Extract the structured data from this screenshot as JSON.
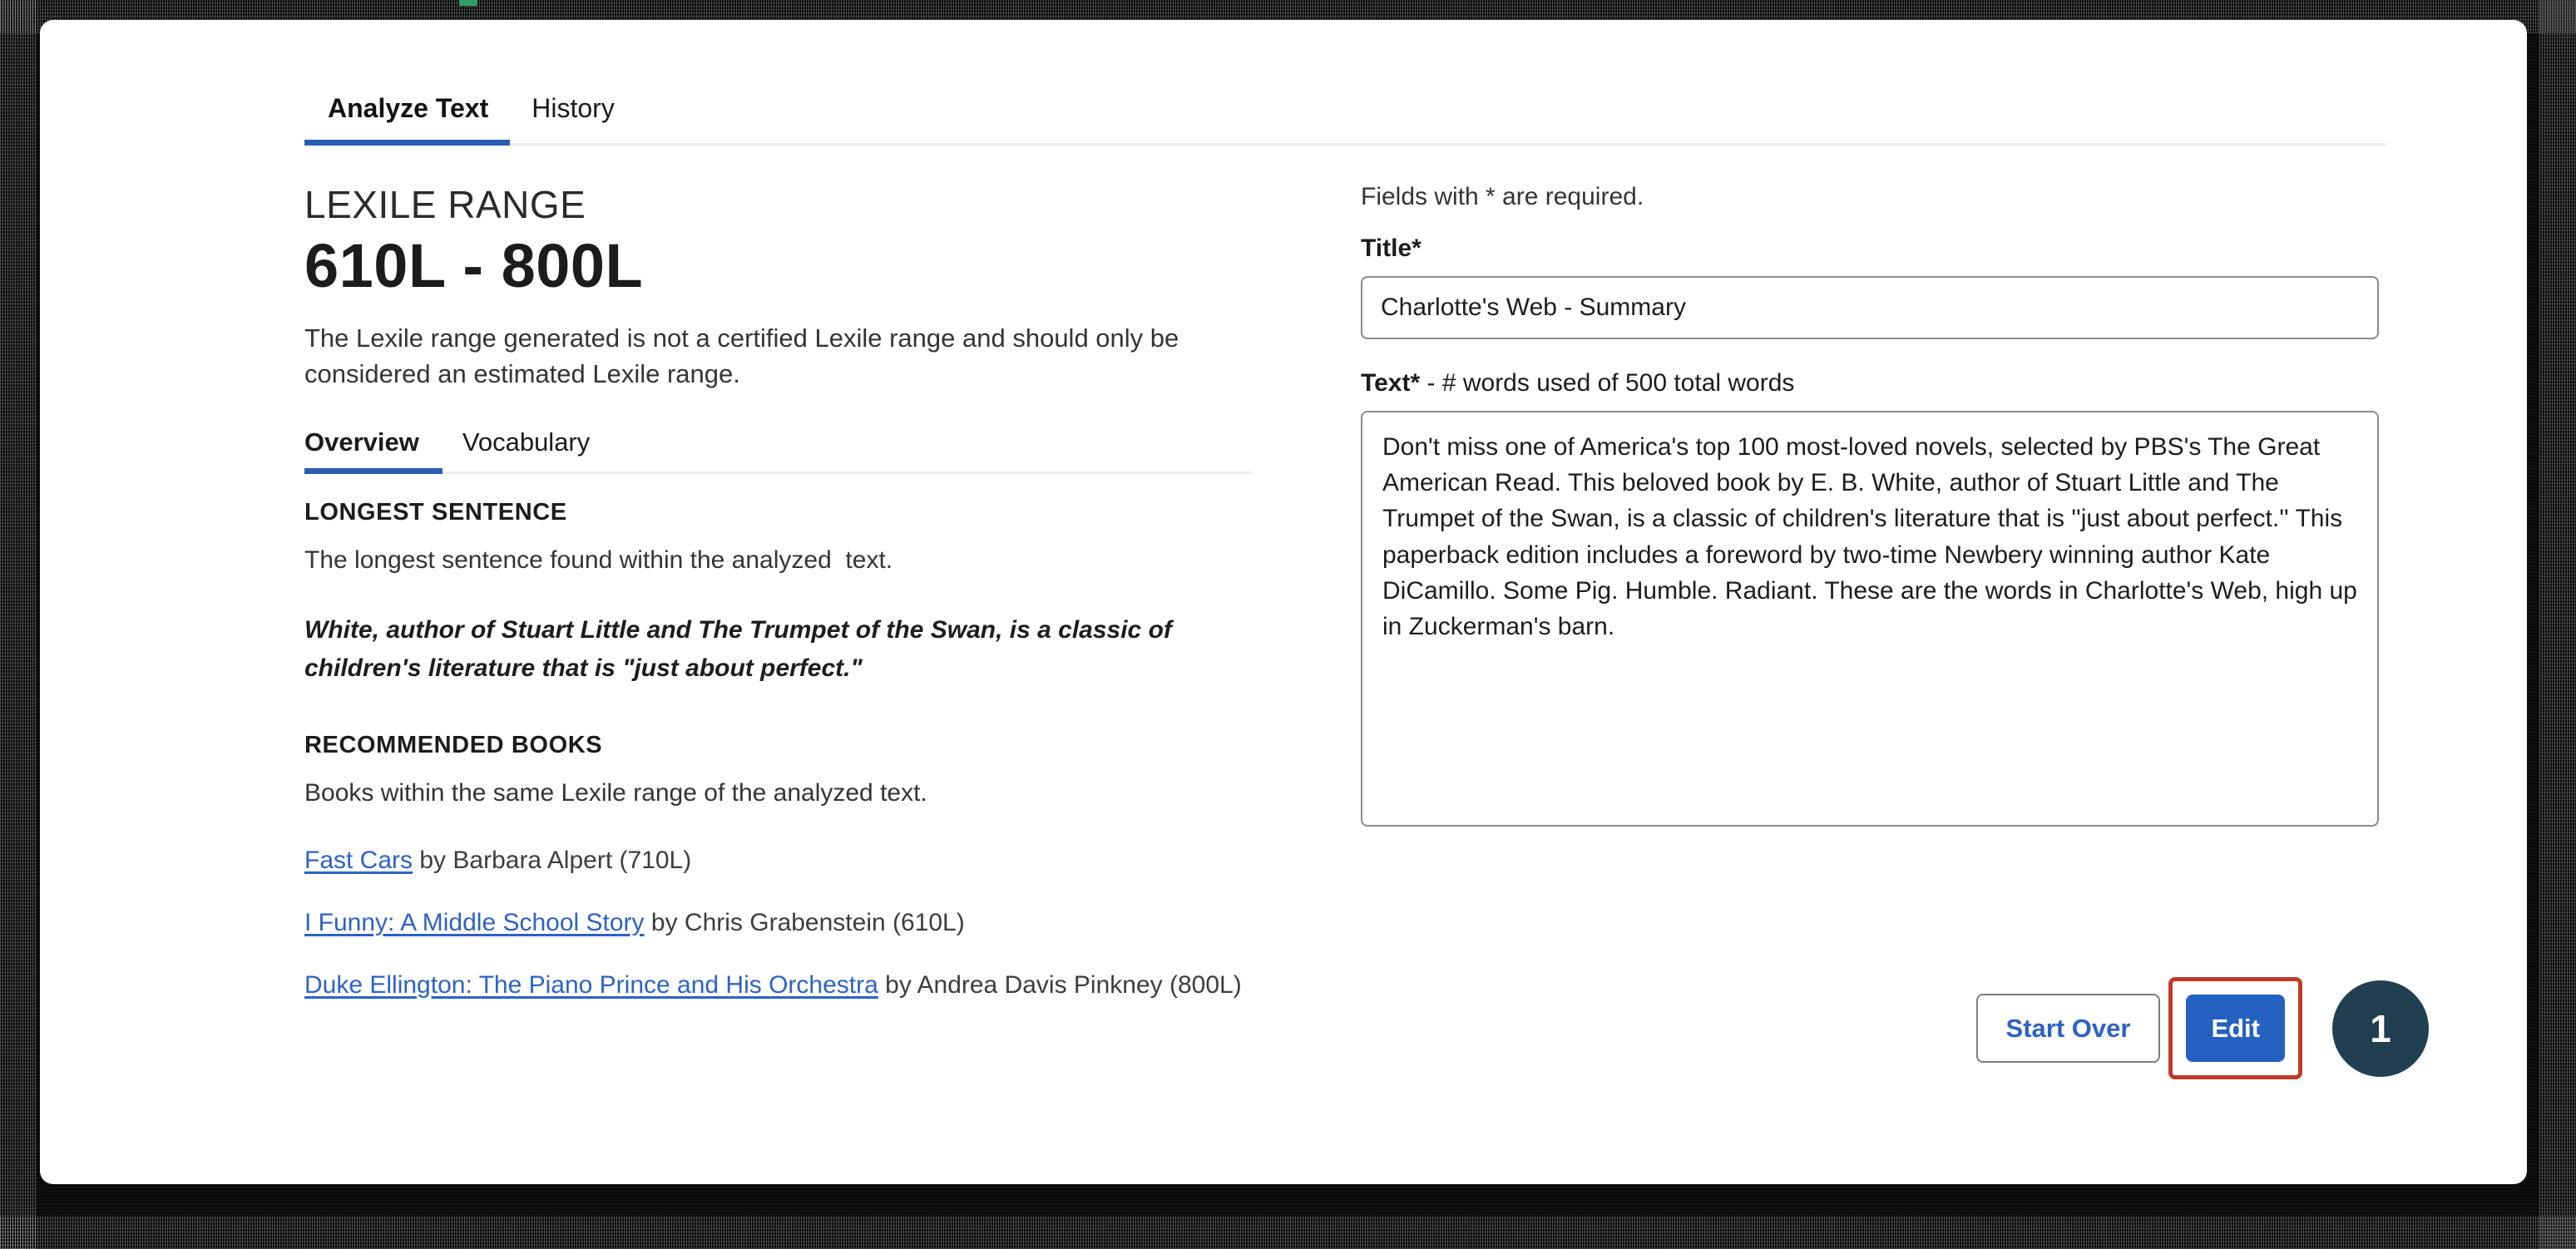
{
  "app": {
    "accent_blue": "#2a5db0",
    "link_blue": "#2d62c4",
    "primary_button_blue": "#2461c0",
    "highlight_red": "#c0392b",
    "badge_navy": "#213f50"
  },
  "tabs": [
    {
      "label": "Analyze Text",
      "active": true
    },
    {
      "label": "History",
      "active": false
    }
  ],
  "result": {
    "kicker": "LEXILE RANGE",
    "range": "610L - 800L",
    "range_min": "610L",
    "range_max": "800L",
    "disclaimer": "The Lexile range generated is not a certified Lexile range and should only be considered an estimated Lexile range.",
    "subtabs": [
      {
        "label": "Overview",
        "active": true
      },
      {
        "label": "Vocabulary",
        "active": false
      }
    ],
    "longest_sentence": {
      "heading": "LONGEST SENTENCE",
      "description": "The longest sentence found within the analyzed  text.",
      "quote": "White, author of Stuart Little and The Trumpet of the Swan, is a classic of children's literature that is \"just about perfect.\""
    },
    "recommended_books": {
      "heading": "RECOMMENDED BOOKS",
      "description": "Books within the same Lexile range of the analyzed text.",
      "items": [
        {
          "title": "Fast Cars",
          "meta": " by Barbara Alpert (710L)"
        },
        {
          "title": "I Funny: A Middle School Story",
          "meta": " by Chris Grabenstein (610L)"
        },
        {
          "title": "Duke Ellington: The Piano Prince and His Orchestra",
          "meta": " by Andrea Davis Pinkney (800L)"
        }
      ]
    }
  },
  "form": {
    "required_note": "Fields with * are required.",
    "title_label": "Title",
    "title_required_mark": "*",
    "title_value": "Charlotte's Web - Summary",
    "title_placeholder": "Title",
    "text_label": "Text",
    "text_required_mark": "*",
    "text_label_extra": "-  # words used of 500 total words",
    "text_value": "Don't miss one of America's top 100 most-loved novels, selected by PBS's The Great American Read. This beloved book by E. B. White, author of Stuart Little and The Trumpet of the Swan, is a classic of children's literature that is ''just about perfect.'' This paperback edition includes a foreword by two-time Newbery winning author Kate DiCamillo. Some Pig. Humble. Radiant. These are the words in Charlotte's Web, high up in Zuckerman's barn.",
    "text_placeholder": "Enter text"
  },
  "actions": {
    "start_over_label": "Start Over",
    "edit_label": "Edit"
  },
  "annotation": {
    "step_number": "1"
  }
}
